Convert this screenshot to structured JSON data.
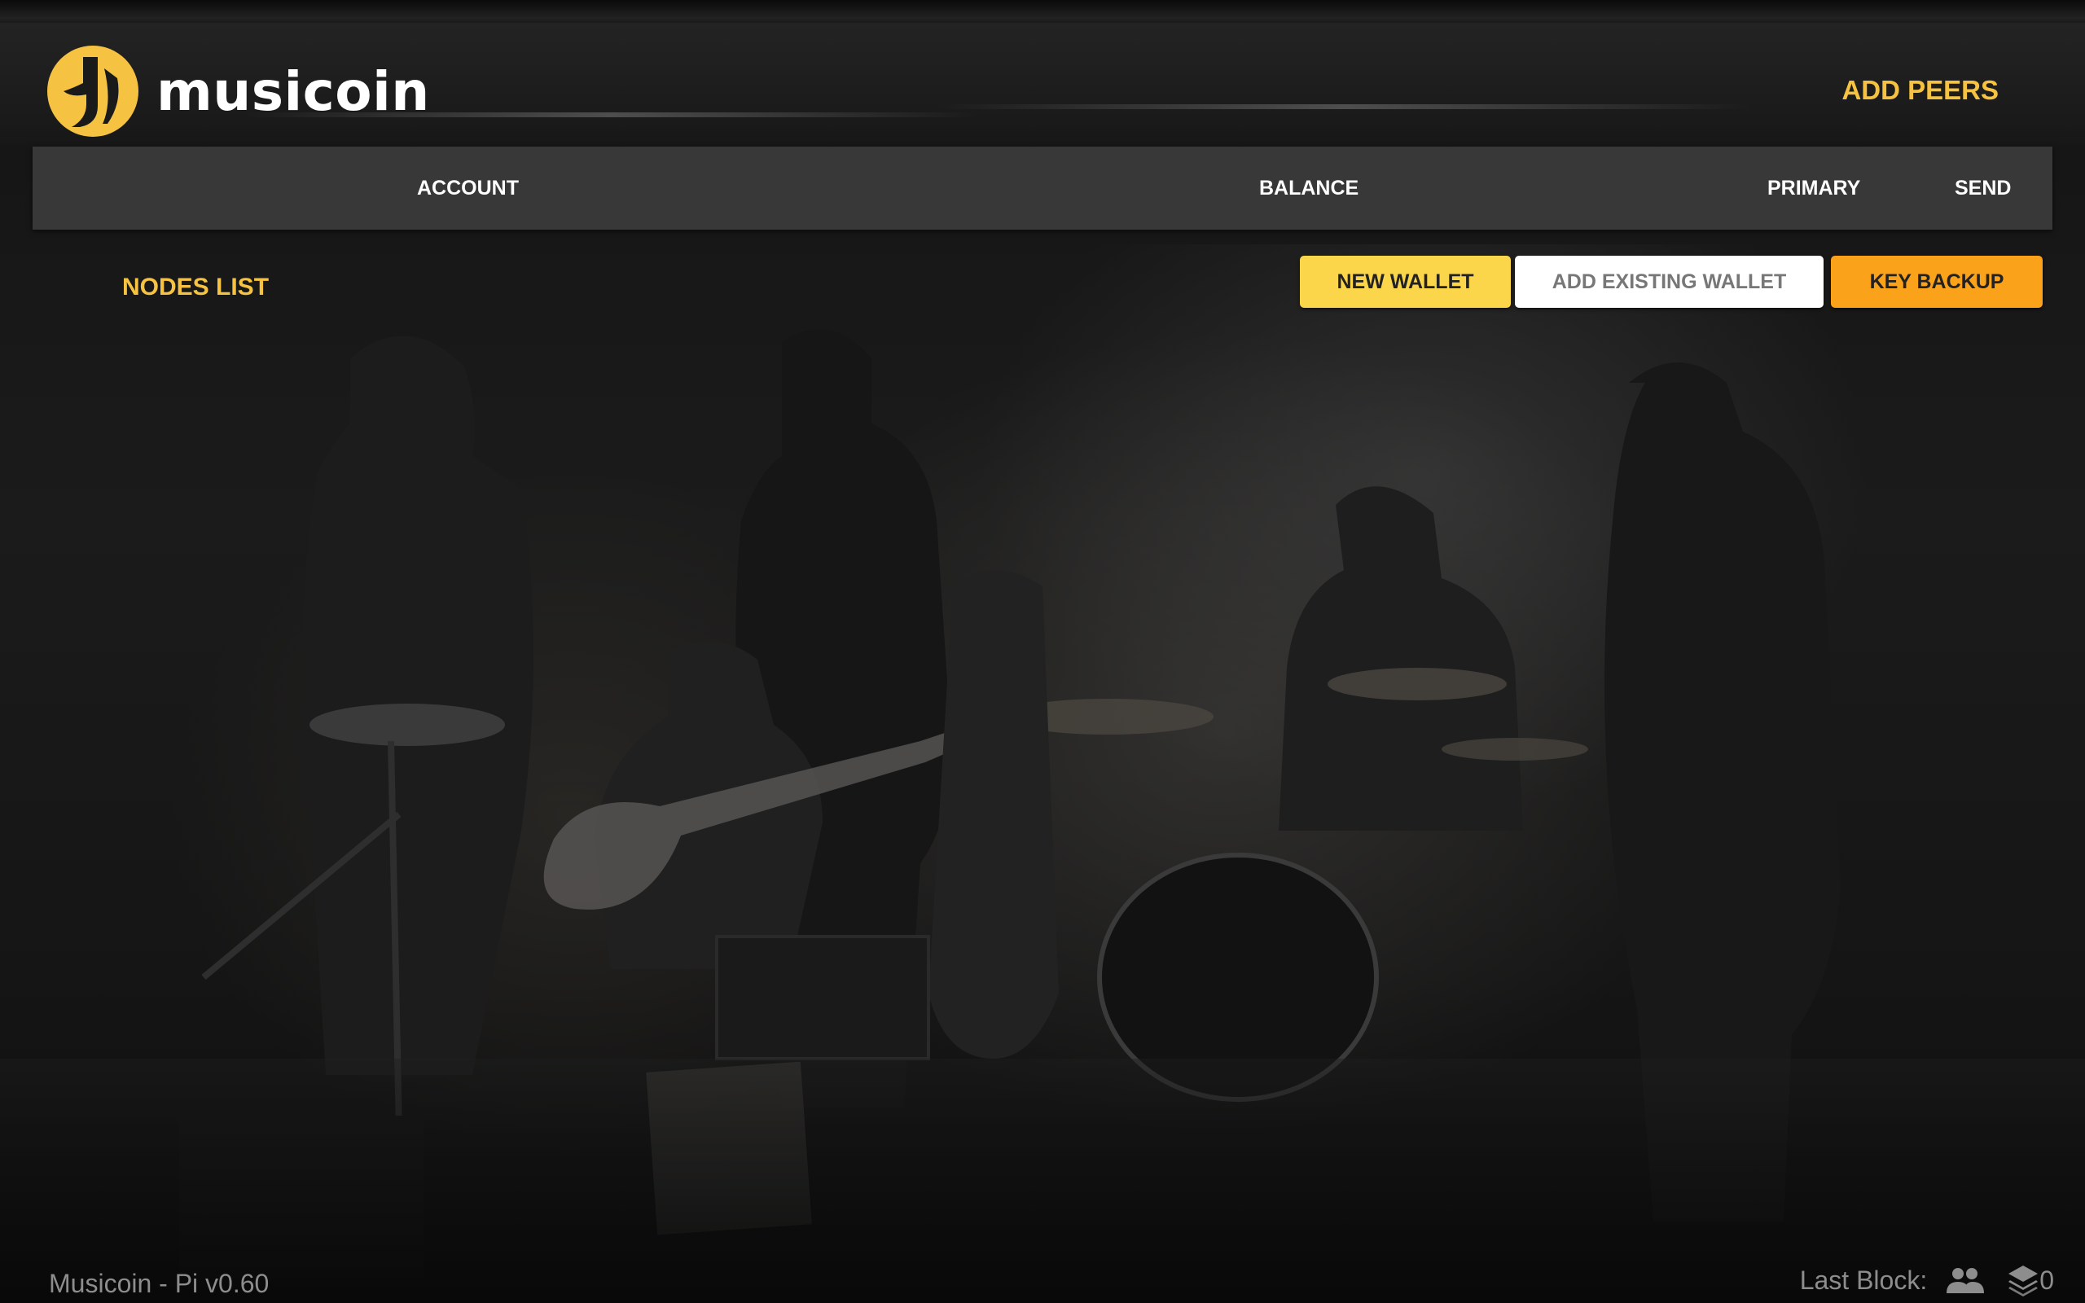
{
  "app": {
    "brand": "musicoin"
  },
  "header": {
    "add_peers_label": "ADD PEERS"
  },
  "table": {
    "columns": [
      "ACCOUNT",
      "BALANCE",
      "PRIMARY",
      "SEND"
    ]
  },
  "nodes_list_label": "NODES LIST",
  "wallet_actions": {
    "new_wallet_label": "NEW WALLET",
    "add_existing_label": "ADD EXISTING WALLET",
    "key_backup_label": "KEY BACKUP"
  },
  "footer": {
    "version": "Musicoin - Pi v0.60",
    "last_block_label": "Last Block:",
    "block_count": "0",
    "icons": [
      "peers-icon",
      "layers-icon"
    ]
  },
  "colors": {
    "accent_yellow": "#f5c242",
    "button_yellow": "#fbd54a",
    "button_orange": "#f9a21a",
    "header_bar": "#3c3c3c"
  }
}
